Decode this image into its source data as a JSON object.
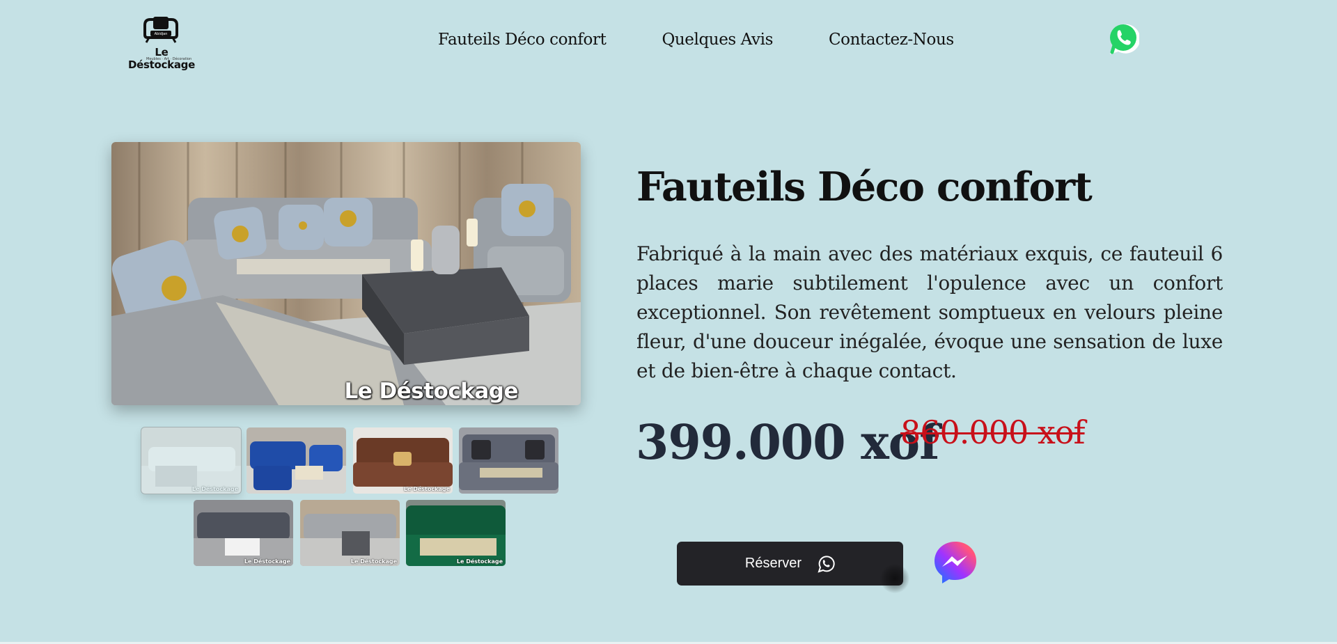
{
  "header": {
    "logo": {
      "brand": "Le Déstockage",
      "badge_text": "Abidjan",
      "tagline": "Meubles · Art · Décoration"
    },
    "nav": [
      {
        "label": "Fauteils Déco confort"
      },
      {
        "label": "Quelques Avis"
      },
      {
        "label": "Contactez-Nous"
      }
    ],
    "whatsapp_icon": "whatsapp-icon"
  },
  "gallery": {
    "main_watermark": "Le Déstockage",
    "thumbnails": [
      {
        "label": "Le Déstockage",
        "active": true
      },
      {
        "label": ""
      },
      {
        "label": "Le Déstockage"
      },
      {
        "label": ""
      },
      {
        "label": "Le Déstockage"
      },
      {
        "label": "Le Déstockage"
      },
      {
        "label": "Le Déstockage"
      }
    ]
  },
  "product": {
    "title": "Fauteils Déco confort",
    "description": "Fabriqué à la main avec des matériaux exquis, ce fauteuil 6 places marie subtilement l'opulence avec un confort exceptionnel. Son revêtement somptueux en velours pleine fleur, d'une douceur inégalée, évoque une sensation de luxe et de bien-être à chaque contact.",
    "price": "399.000 xof",
    "old_price": "860.000 xof",
    "reserve_label": "Réserver"
  },
  "colors": {
    "background": "#c5e1e5",
    "button": "#232327",
    "old_price": "#c8101a",
    "whatsapp": "#25d366"
  }
}
